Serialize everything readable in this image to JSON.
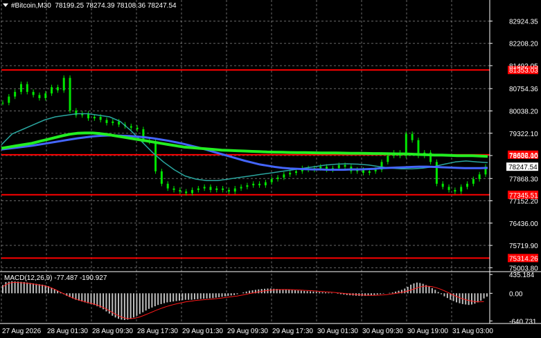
{
  "header": {
    "symbol": "#Bitcoin,M30",
    "open": "78199.25",
    "high": "78274.39",
    "low": "78108.36",
    "close": "78247.54"
  },
  "colors": {
    "background": "#000000",
    "grid": "#bfbfbf",
    "candle": "#00e600",
    "hline": "#ff0000",
    "ma_green": "#22ee22",
    "ma_blue": "#4466ff",
    "ma_teal": "#2aa7a0",
    "macd_hist": "#c0c0c0",
    "macd_signal": "#ff1a1a"
  },
  "chart_data": [
    {
      "type": "line",
      "title": "#Bitcoin,M30",
      "x_tick_labels": [
        "27 Aug 2026",
        "28 Aug 01:30",
        "28 Aug 09:30",
        "28 Aug 17:30",
        "29 Aug 01:30",
        "29 Aug 09:30",
        "29 Aug 17:30",
        "30 Aug 01:30",
        "30 Aug 09:30",
        "30 Aug 19:00",
        "31 Aug 03:00"
      ],
      "y_tick_labels": [
        "82924.35",
        "82208.20",
        "81492.05",
        "80754.36",
        "80038.20",
        "79322.10",
        "78606.00",
        "77868.30",
        "77152.20",
        "76436.00",
        "75719.90",
        "75003.80"
      ],
      "ylim": [
        74900,
        83600
      ],
      "horizontal_levels": [
        {
          "value": 81353.03,
          "label": "81353.03"
        },
        {
          "value": 78632.16,
          "label": "78632.16"
        },
        {
          "value": 77345.51,
          "label": "77345.51"
        },
        {
          "value": 75314.26,
          "label": "75314.26"
        }
      ],
      "current_price": {
        "value": 78247.54,
        "label": "78247.54"
      },
      "series": [
        {
          "values": [
            80300,
            80500,
            80650,
            80900,
            80650,
            80550,
            80450,
            80600,
            80800,
            80700,
            81100,
            80050,
            79900,
            79950,
            79800,
            79850,
            79750,
            79650,
            79700,
            79600,
            79550,
            79500,
            79450,
            79100,
            79050,
            78100,
            77700,
            77550,
            77500,
            77450,
            77400,
            77500,
            77550,
            77600,
            77500,
            77550,
            77500,
            77450,
            77550,
            77600,
            77650,
            77700,
            77650,
            77750,
            77850,
            77900,
            78000,
            78050,
            78100,
            78200,
            78150,
            78200,
            78250,
            78150,
            78200,
            78300,
            78250,
            78100,
            78150,
            78050,
            78100,
            78150,
            78400,
            78600,
            78700,
            78600,
            79300,
            79100,
            78600,
            78700,
            78400,
            77700,
            77600,
            77500,
            77450,
            77600,
            77700,
            77850,
            78000,
            78250
          ]
        },
        {
          "values": [
            78840,
            78880,
            78920,
            78960,
            79000,
            79060,
            79120,
            79180,
            79240,
            79290,
            79320,
            79330,
            79330,
            79310,
            79280,
            79240,
            79200,
            79160,
            79120,
            79080,
            79040,
            79000,
            78960,
            78920,
            78880,
            78860,
            78840,
            78820,
            78800,
            78780,
            78770,
            78760,
            78750,
            78740,
            78730,
            78720,
            78715,
            78710,
            78705,
            78700,
            78700,
            78695,
            78690,
            78690,
            78690,
            78685,
            78680,
            78680,
            78675,
            78670,
            78670,
            78665,
            78660,
            78660,
            78650,
            78640,
            78630,
            78620,
            78620,
            78610,
            78600,
            78600,
            78600,
            78590,
            78580
          ]
        },
        {
          "values": [
            78800,
            78830,
            78860,
            78890,
            78920,
            78960,
            79000,
            79040,
            79080,
            79120,
            79160,
            79190,
            79220,
            79240,
            79250,
            79250,
            79240,
            79230,
            79210,
            79190,
            79160,
            79120,
            79080,
            79030,
            78980,
            78920,
            78860,
            78790,
            78720,
            78650,
            78580,
            78510,
            78440,
            78380,
            78320,
            78280,
            78240,
            78210,
            78190,
            78180,
            78170,
            78160,
            78160,
            78150,
            78150,
            78150,
            78160,
            78160,
            78170,
            78180,
            78200,
            78210,
            78220,
            78230,
            78240,
            78250,
            78250,
            78240,
            78230,
            78220,
            78210,
            78200,
            78200,
            78200,
            78210
          ]
        },
        {
          "values": [
            78950,
            79300,
            79450,
            79600,
            79750,
            79850,
            79900,
            79950,
            79950,
            79900,
            79850,
            79700,
            79400,
            79050,
            78700,
            78400,
            78150,
            77950,
            77850,
            77800,
            77800,
            77850,
            77900,
            77950,
            78000,
            78050,
            78100,
            78150,
            78200,
            78250,
            78300,
            78330,
            78340,
            78330,
            78300,
            78250,
            78200,
            78180,
            78180,
            78200,
            78250,
            78330,
            78400,
            78430,
            78400,
            78380
          ]
        }
      ]
    },
    {
      "type": "bar",
      "title": "MACD(12,26,9) -77.487 -190.927",
      "y_tick_labels": [
        "435.184",
        "0.00",
        "-640.731"
      ],
      "ylim": [
        -700,
        470
      ],
      "series": [
        {
          "values": [
            190,
            260,
            270,
            280,
            275,
            270,
            265,
            260,
            250,
            240,
            230,
            220,
            210,
            200,
            185,
            165,
            130,
            100,
            60,
            20,
            -20,
            -60,
            -90,
            -120,
            -150,
            -170,
            -190,
            -210,
            -230,
            -250,
            -270,
            -300,
            -330,
            -370,
            -420,
            -470,
            -520,
            -560,
            -590,
            -610,
            -620,
            -610,
            -590,
            -560,
            -520,
            -480,
            -440,
            -400,
            -360,
            -330,
            -300,
            -270,
            -250,
            -230,
            -210,
            -200,
            -190,
            -180,
            -170,
            -160,
            -150,
            -150,
            -150,
            -140,
            -135,
            -130,
            -125,
            -120,
            -115,
            -110,
            -100,
            -90,
            -80,
            -70,
            -60,
            -50,
            -40,
            -20,
            0,
            20,
            40,
            60,
            70,
            80,
            90,
            100,
            105,
            110,
            110,
            105,
            100,
            95,
            90,
            85,
            80,
            75,
            70,
            65,
            60,
            55,
            50,
            45,
            40,
            35,
            30,
            25,
            20,
            15,
            10,
            0,
            -10,
            -20,
            -30,
            -40,
            -45,
            -50,
            -55,
            -60,
            -60,
            -60,
            -55,
            -50,
            -40,
            -30,
            -20,
            -10,
            0,
            10,
            20,
            40,
            60,
            80,
            110,
            150,
            200,
            230,
            250,
            240,
            220,
            190,
            160,
            120,
            80,
            30,
            -20,
            -70,
            -110,
            -150,
            -180,
            -210,
            -230,
            -250,
            -260,
            -270,
            -260,
            -240,
            -210,
            -170,
            -120,
            -77
          ]
        },
        {
          "values": [
            150,
            200,
            230,
            250,
            255,
            250,
            245,
            240,
            232,
            225,
            215,
            205,
            195,
            185,
            170,
            150,
            125,
            95,
            60,
            25,
            -10,
            -45,
            -78,
            -108,
            -135,
            -158,
            -178,
            -197,
            -215,
            -233,
            -252,
            -275,
            -300,
            -330,
            -365,
            -405,
            -445,
            -485,
            -520,
            -550,
            -572,
            -585,
            -588,
            -582,
            -568,
            -548,
            -522,
            -494,
            -465,
            -435,
            -405,
            -377,
            -350,
            -325,
            -302,
            -281,
            -262,
            -245,
            -229,
            -214,
            -200,
            -189,
            -180,
            -170,
            -162,
            -155,
            -149,
            -143,
            -137,
            -131,
            -124,
            -116,
            -108,
            -99,
            -90,
            -81,
            -72,
            -62,
            -50,
            -37,
            -23,
            -8,
            6,
            20,
            33,
            45,
            56,
            66,
            74,
            80,
            84,
            86,
            87,
            87,
            86,
            84,
            81,
            78,
            74,
            70,
            66,
            61,
            56,
            51,
            46,
            41,
            36,
            31,
            25,
            19,
            12,
            5,
            -2,
            -9,
            -16,
            -23,
            -29,
            -35,
            -40,
            -44,
            -47,
            -48,
            -47,
            -45,
            -41,
            -36,
            -30,
            -22,
            -13,
            -3,
            9,
            22,
            37,
            55,
            75,
            100,
            125,
            145,
            160,
            165,
            162,
            152,
            136,
            114,
            88,
            58,
            26,
            -8,
            -41,
            -73,
            -102,
            -127,
            -149,
            -167,
            -181,
            -191,
            -196,
            -197,
            -191
          ]
        }
      ]
    }
  ]
}
